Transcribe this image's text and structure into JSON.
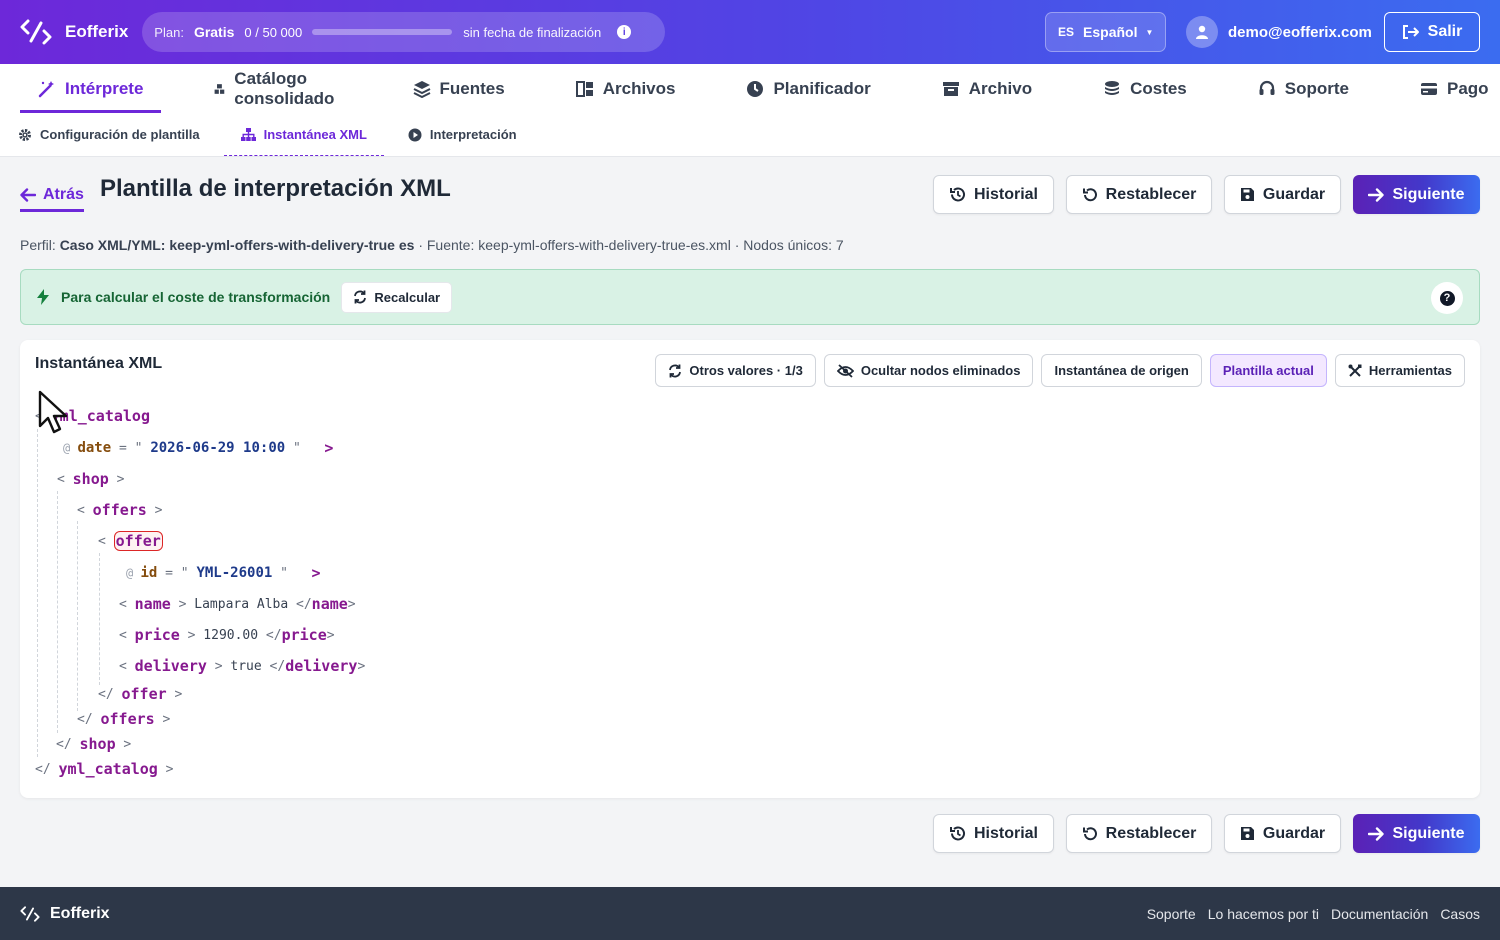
{
  "app": {
    "brand": "Eofferix"
  },
  "plan": {
    "label": "Plan:",
    "name": "Gratis",
    "count": "0 / 50 000",
    "usage_fraction": 0.0,
    "end": "sin fecha de finalización"
  },
  "lang": {
    "code": "ES",
    "name": "Español"
  },
  "user": {
    "email": "demo@eofferix.com",
    "logout": "Salir"
  },
  "nav": [
    {
      "label": "Intérprete",
      "icon": "magic-wand-icon",
      "active": true
    },
    {
      "label": "Catálogo consolidado",
      "icon": "cubes-icon"
    },
    {
      "label": "Fuentes",
      "icon": "layers-icon"
    },
    {
      "label": "Archivos",
      "icon": "files-icon"
    },
    {
      "label": "Planificador",
      "icon": "clock-icon"
    },
    {
      "label": "Archivo",
      "icon": "archive-icon"
    },
    {
      "label": "Costes",
      "icon": "coins-icon"
    },
    {
      "label": "Soporte",
      "icon": "headset-icon"
    },
    {
      "label": "Pago",
      "icon": "credit-card-icon"
    }
  ],
  "subnav": [
    {
      "label": "Configuración de plantilla",
      "icon": "gear-icon"
    },
    {
      "label": "Instantánea XML",
      "icon": "sitemap-icon",
      "active": true
    },
    {
      "label": "Interpretación",
      "icon": "play-circle-icon"
    }
  ],
  "header": {
    "back": "Atrás",
    "title": "Plantilla de interpretación XML"
  },
  "actions": {
    "history": "Historial",
    "reset": "Restablecer",
    "save": "Guardar",
    "next": "Siguiente"
  },
  "profile": {
    "profile_label": "Perfil:",
    "profile_value": "Caso XML/YML: keep-yml-offers-with-delivery-true es",
    "rest": " · Fuente: keep-yml-offers-with-delivery-true-es.xml · Nodos únicos: 7"
  },
  "banner": {
    "text": "Para calcular el coste de transformación",
    "recalc": "Recalcular",
    "help": "?"
  },
  "panel": {
    "title": "Instantánea XML",
    "tools": {
      "other_values": "Otros valores · 1/3",
      "hide_deleted": "Ocultar nodos eliminados",
      "source_snapshot": "Instantánea de origen",
      "current_template": "Plantilla actual",
      "tools": "Herramientas"
    }
  },
  "xml": {
    "root": "yml_catalog",
    "date_attr": "date",
    "date_value": "2026-06-29 10:00",
    "shop": "shop",
    "offers": "offers",
    "offer": "offer",
    "id_attr": "id",
    "id_value": "YML-26001",
    "name_tag": "name",
    "name_value": "Lampara Alba",
    "price_tag": "price",
    "price_value": "1290.00",
    "delivery_tag": "delivery",
    "delivery_value": "true"
  },
  "footer": {
    "brand": "Eofferix",
    "links": [
      "Soporte",
      "Lo hacemos por ti",
      "Documentación",
      "Casos"
    ]
  },
  "colors": {
    "accent": "#6d28d9",
    "banner_bg": "#d9f2e5",
    "tag": "#86198f",
    "attr": "#854d0e",
    "attr_value": "#1e3a8a"
  }
}
